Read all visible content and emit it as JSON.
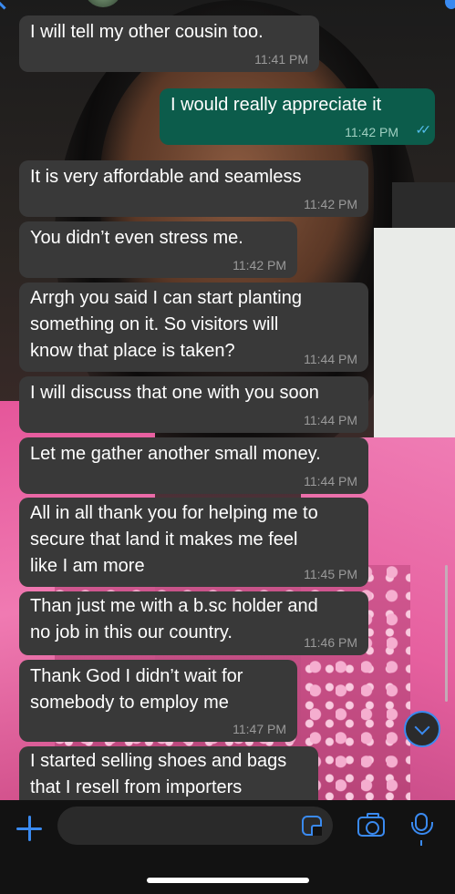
{
  "colors": {
    "incoming_bubble": "#393939",
    "outgoing_bubble": "#0c5c4b",
    "accent": "#3a8af0",
    "read_ticks": "#53bdeb"
  },
  "messages": [
    {
      "dir": "in",
      "text": "I will tell my other cousin too.",
      "time": "11:41 PM"
    },
    {
      "dir": "out",
      "text": "I would really appreciate it",
      "time": "11:42 PM",
      "status": "read"
    },
    {
      "dir": "in",
      "text": "It is very affordable and seamless",
      "time": "11:42 PM"
    },
    {
      "dir": "in",
      "text": "You didn’t even stress me.",
      "time": "11:42 PM"
    },
    {
      "dir": "in",
      "text": "Arrgh you said I can start planting\nsomething on it. So visitors will\nknow that place is taken?",
      "time": "11:44 PM"
    },
    {
      "dir": "in",
      "text": "I will discuss that one with you soon",
      "time": "11:44 PM"
    },
    {
      "dir": "in",
      "text": "Let me gather another small money.",
      "time": "11:44 PM"
    },
    {
      "dir": "in",
      "text": "All in all thank you for helping me to\nsecure that land it makes me feel\nlike I am more",
      "time": "11:45 PM"
    },
    {
      "dir": "in",
      "text": "Than just me with a b.sc holder and\nno job in this our country.",
      "time": "11:46 PM"
    },
    {
      "dir": "in",
      "text": "Thank God I didn’t wait for\nsomebody to employ me",
      "time": "11:47 PM"
    },
    {
      "dir": "in",
      "text": "I started selling shoes and bags\nthat I resell from importers",
      "time": ""
    }
  ],
  "composer": {
    "plus_icon": "plus-icon",
    "sticker_icon": "sticker-icon",
    "camera_icon": "camera-icon",
    "mic_icon": "mic-icon"
  }
}
